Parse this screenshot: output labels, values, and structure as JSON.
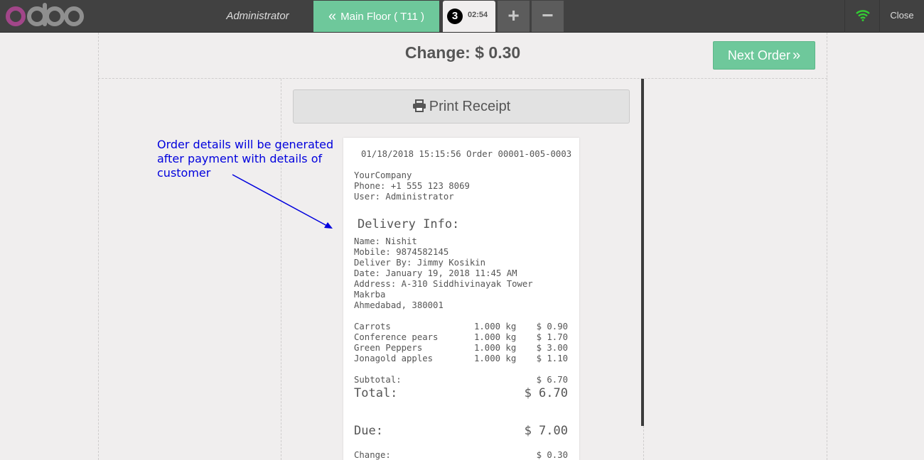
{
  "header": {
    "logo_text": "odoo",
    "cashier": "Administrator",
    "floor_button": "Main Floor ( T11 )",
    "order_tab": {
      "number": "3",
      "time": "02:54"
    },
    "add_order_symbol": "+",
    "remove_order_symbol": "−",
    "close_label": "Close"
  },
  "screen": {
    "change_title": "Change: $ 0.30",
    "next_order_label": "Next Order",
    "print_receipt_label": "Print Receipt"
  },
  "receipt": {
    "datetime_order": "01/18/2018 15:15:56 Order 00001-005-0003",
    "company": "YourCompany",
    "phone": "Phone: +1 555 123 8069",
    "user": "User: Administrator",
    "delivery_title": "Delivery Info:",
    "name": "Name: Nishit",
    "mobile": "Mobile: 9874582145",
    "deliver_by": "Deliver By: Jimmy Kosikin",
    "date": "Date: January 19, 2018 11:45 AM",
    "address_1": "Address: A-310 Siddhivinayak Tower",
    "address_2": "Makrba",
    "address_3": "Ahmedabad, 380001",
    "lines": [
      {
        "product": "Carrots",
        "qty": "1.000 kg",
        "price": "$ 0.90"
      },
      {
        "product": "Conference pears",
        "qty": "1.000 kg",
        "price": "$ 1.70"
      },
      {
        "product": "Green Peppers",
        "qty": "1.000 kg",
        "price": "$ 3.00"
      },
      {
        "product": "Jonagold apples",
        "qty": "1.000 kg",
        "price": "$ 1.10"
      }
    ],
    "subtotal_label": "Subtotal:",
    "subtotal_value": "$ 6.70",
    "total_label": "Total:",
    "total_value": "$ 6.70",
    "due_label": "Due:",
    "due_value": "$ 7.00",
    "change_label": "Change:",
    "change_value": "$ 0.30"
  },
  "annotation": {
    "line_1": "Order details will be generated",
    "line_2": "after payment with details of",
    "line_3": "customer"
  },
  "colors": {
    "accent_green": "#6ec89b",
    "topbar": "#414141",
    "annotation_blue": "#0000dd",
    "logo_purple": "#a24689",
    "wifi_green": "#33cc33"
  },
  "icons": [
    "wifi-icon",
    "printer-icon",
    "double-chevron-left-icon",
    "double-chevron-right-icon"
  ]
}
